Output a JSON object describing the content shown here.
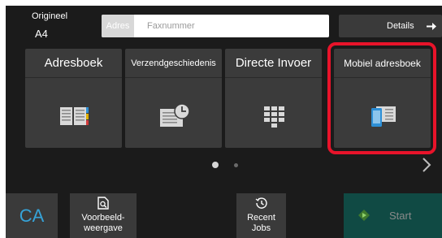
{
  "original": {
    "label": "Origineel",
    "value": "A4"
  },
  "address": {
    "tag": "Adres",
    "placeholder": "Faxnummer"
  },
  "details": {
    "label": "Details"
  },
  "tiles": [
    {
      "label": "Adresboek",
      "icon": "address-book-icon"
    },
    {
      "label": "Verzendgeschiedenis",
      "icon": "send-history-icon"
    },
    {
      "label": "Directe Invoer",
      "icon": "keypad-icon"
    },
    {
      "label": "Mobiel adresboek",
      "icon": "mobile-address-book-icon"
    }
  ],
  "pager": {
    "pages": 2,
    "current": 1
  },
  "bottom": {
    "ca": "CA",
    "preview": "Voorbeeld-\nweergave",
    "recent": "Recent\nJobs",
    "start": "Start"
  },
  "colors": {
    "highlight": "#e8132a",
    "ca_text": "#36a3d8",
    "start_bg": "#104a44",
    "icon_blue": "#2d8fd6"
  }
}
